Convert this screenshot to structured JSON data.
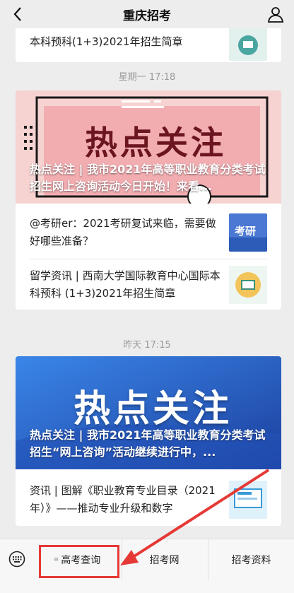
{
  "header": {
    "title": "重庆招考"
  },
  "feed": {
    "top_partial": {
      "text": "本科预科(1+3)2021年招生简章"
    },
    "groups": [
      {
        "time": "星期一 17:18",
        "cover": {
          "word": "热点关注",
          "headline": "热点关注 | 我市2021年高等职业教育分类考试招生网上咨询活动今日开始！来看...",
          "accent": "#f0a1a8"
        },
        "items": [
          {
            "text": "@考研er：2021考研复试来临，需要做好哪些准备？",
            "thumb_text": "考研"
          },
          {
            "text": "留学资讯 | 西南大学国际教育中心国际本科预科 (1+3)2021年招生简章",
            "thumb_text": ""
          }
        ]
      },
      {
        "time": "昨天 17:15",
        "cover": {
          "word": "热点关注",
          "headline": "热点关注 | 我市2021年高等职业教育分类考试招生“网上咨询”活动继续进行中，...",
          "accent": "#2f6fd6"
        },
        "items": [
          {
            "text": "资讯 | 图解《职业教育专业目录（2021年）》——推动专业升级和数字",
            "thumb_text": ""
          }
        ]
      }
    ]
  },
  "bottom_menu": {
    "items": [
      {
        "label": "高考查询"
      },
      {
        "label": "招考网"
      },
      {
        "label": "招考资料"
      }
    ]
  },
  "colors": {
    "highlight": "#e53935",
    "background": "#ededed"
  }
}
